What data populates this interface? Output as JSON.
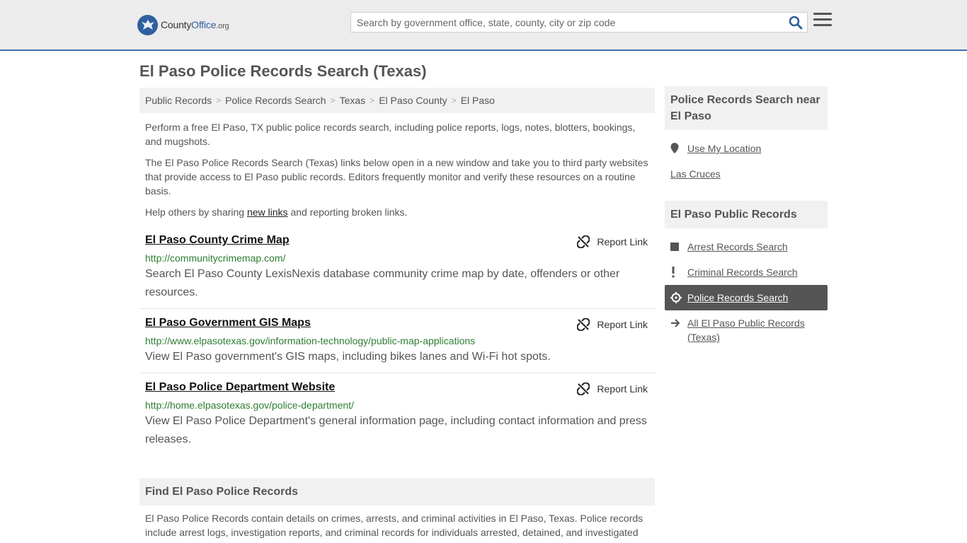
{
  "header": {
    "logo": {
      "county": "County",
      "office": "Office",
      "org": ".org"
    },
    "search_placeholder": "Search by government office, state, county, city or zip code"
  },
  "page_title": "El Paso Police Records Search (Texas)",
  "breadcrumb": [
    "Public Records",
    "Police Records Search",
    "Texas",
    "El Paso County",
    "El Paso"
  ],
  "intro": {
    "p1": "Perform a free El Paso, TX public police records search, including police reports, logs, notes, blotters, bookings, and mugshots.",
    "p2": "The El Paso Police Records Search (Texas) links below open in a new window and take you to third party websites that provide access to El Paso public records. Editors frequently monitor and verify these resources on a routine basis.",
    "p3_before": "Help others by sharing ",
    "p3_link": "new links",
    "p3_after": " and reporting broken links."
  },
  "report_label": "Report Link",
  "results": [
    {
      "title": "El Paso County Crime Map",
      "url": "http://communitycrimemap.com/",
      "desc": "Search El Paso County LexisNexis database community crime map by date, offenders or other resources."
    },
    {
      "title": "El Paso Government GIS Maps",
      "url": "http://www.elpasotexas.gov/information-technology/public-map-applications",
      "desc": "View El Paso government's GIS maps, including bikes lanes and Wi-Fi hot spots."
    },
    {
      "title": "El Paso Police Department Website",
      "url": "http://home.elpasotexas.gov/police-department/",
      "desc": "View El Paso Police Department's general information page, including contact information and press releases."
    }
  ],
  "find_section": {
    "title": "Find El Paso Police Records",
    "text": "El Paso Police Records contain details on crimes, arrests, and criminal activities in El Paso, Texas. Police records include arrest logs, investigation reports, and criminal records for individuals arrested, detained, and investigated"
  },
  "sidebar": {
    "nearby_title": "Police Records Search near El Paso",
    "use_location": "Use My Location",
    "nearby_city": "Las Cruces",
    "records_title": "El Paso Public Records",
    "links": [
      "Arrest Records Search",
      "Criminal Records Search",
      "Police Records Search",
      "All El Paso Public Records (Texas)"
    ]
  },
  "colors": {
    "accent_border": "#3f6fb5",
    "url_green": "#2e7d32",
    "active_bg": "#555555"
  }
}
